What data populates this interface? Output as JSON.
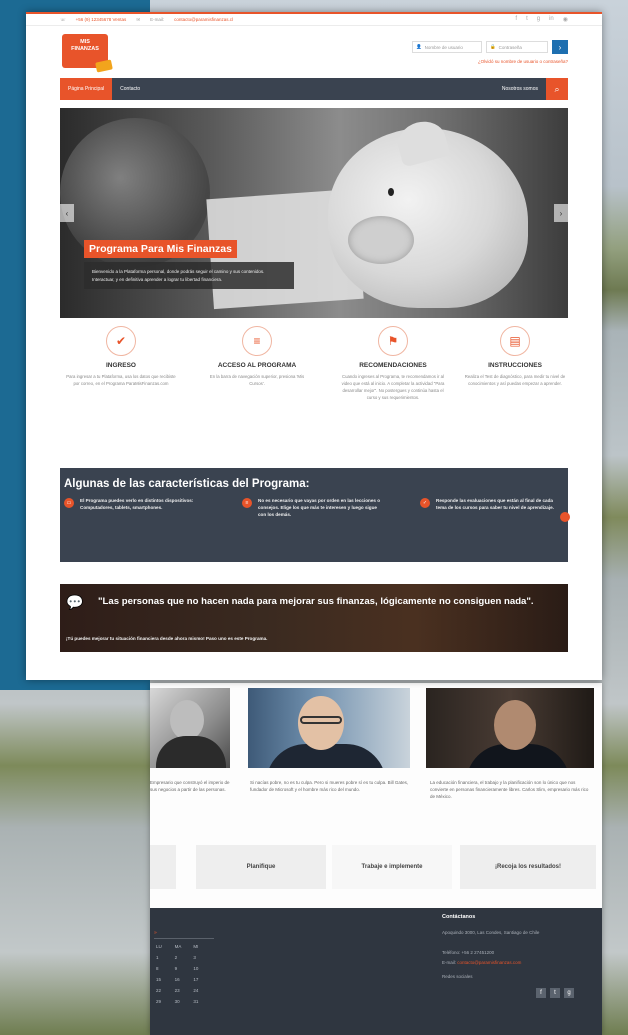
{
  "top_bar": {
    "phone_text": "+56 (9) 12345678 Ventas",
    "email_label": "E-mail:",
    "email_value": "contacto@paramisfinanzas.cl",
    "social_icons": [
      "facebook-icon",
      "twitter-icon",
      "google-plus-icon",
      "linkedin-icon",
      "rss-icon"
    ]
  },
  "header": {
    "logo_text": "MIS FINANZAS",
    "username_placeholder": "Nombre de usuario",
    "password_placeholder": "Contraseña",
    "login_arrow": "›",
    "forgot_link": "¿Olvidó su nombre de usuario o contraseña?"
  },
  "nav": {
    "items": [
      "Página Principal",
      "Contacto"
    ],
    "right_item": "Nosotros somos",
    "search_icon": "⌕"
  },
  "hero": {
    "title": "Programa Para Mis Finanzas",
    "description": "Bienvenido a la Plataforma personal, donde podrás seguir el camino y sus contenidos. Interactuar, y en definitiva aprender a lograr tu libertad financiera.",
    "prev": "‹",
    "next": "›"
  },
  "features": [
    {
      "icon": "twitter-icon",
      "glyph": "✔",
      "title": "INGRESO",
      "text": "Para ingresar a tu Plataforma, usa los datos que recibiste por correo, en el Programa ParaMisFinanzas.com"
    },
    {
      "icon": "sliders-icon",
      "glyph": "≡",
      "title": "ACCESO AL PROGRAMA",
      "text": "En la barra de navegación superior, presiona 'Mis Cursos'."
    },
    {
      "icon": "flag-icon",
      "glyph": "⚑",
      "title": "RECOMENDACIONES",
      "text": "Cuando ingreses al Programa, te recomendamos ir al video que está al inicio. A completar la actividad \"Para desarrollar mejor\". No postergues y continúa hasta el curso y sus requerimientos."
    },
    {
      "icon": "book-icon",
      "glyph": "▤",
      "title": "INSTRUCCIONES",
      "text": "Realiza el Test de diagnóstico, para medir tu nivel de conocimientos y así puedas empezar a aprender."
    }
  ],
  "characteristics": {
    "title": "Algunas de las características del Programa:",
    "items": [
      "El Programa puedes verlo en distintos dispositivos: Computadores, tablets, smartphones.",
      "No es necesario que vayas por orden en las lecciones o consejos. Elige los que más te interesen y luego sigue con los demás.",
      "Responde las evaluaciones que están al final de cada tema de los cursos para saber tu nivel de aprendizaje."
    ]
  },
  "quote": {
    "text": "\"Las personas que no hacen nada para mejorar sus finanzas, lógicamente no consiguen nada\".",
    "sub": "¡Tú puedes mejorar tu situación financiera desde ahora mismo! Paso uno es este Programa."
  },
  "testimonials": [
    {
      "text": "Empresario que construyó el imperio de sus negocios a partir de las personas."
    },
    {
      "text": "Si nacías pobre, no es tu culpa. Pero si mueres pobre sí es tu culpa. Bill Gates, fundador de Microsoft y el hombre más rico del mundo."
    },
    {
      "text": "La educación financiera, el trabajo y la planificación son lo único que nos convierte en personas financieramente libres. Carlos Slim, empresario más rico de México."
    }
  ],
  "steps": [
    "Planifique",
    "Trabaje e implemente",
    "¡Recoja los resultados!"
  ],
  "footer": {
    "calendar_label": "»",
    "calendar_cells": [
      "LU",
      "MA",
      "MI",
      "1",
      "2",
      "3",
      "8",
      "9",
      "10",
      "15",
      "16",
      "17",
      "22",
      "23",
      "24",
      "29",
      "30",
      "31"
    ],
    "contact_title": "Contáctanos",
    "address": "Apoquindo 3000, Las Condes, Santiago de Chile",
    "phone": "Teléfono: +56 2 27451200",
    "email_label": "E-mail:",
    "email_value": "contacto@paramisfinanzas.com",
    "social_label": "Redes sociales",
    "social_glyphs": [
      "f",
      "t",
      "g"
    ]
  }
}
